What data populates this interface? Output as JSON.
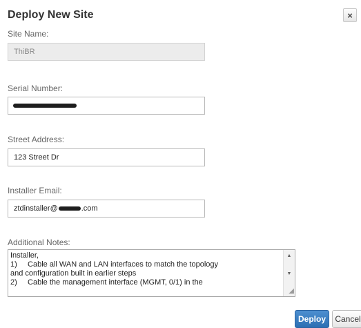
{
  "dialog": {
    "title": "Deploy New Site",
    "close_label": "×"
  },
  "fields": {
    "site_name": {
      "label": "Site Name:",
      "value": "ThiBR",
      "disabled": true
    },
    "serial_number": {
      "label": "Serial Number:",
      "value_redacted": true
    },
    "street_address": {
      "label": "Street Address:",
      "value": "123 Street Dr"
    },
    "installer_email": {
      "label": "Installer Email:",
      "value_prefix": "ztdinstaller@",
      "value_suffix": ".com",
      "domain_redacted": true
    },
    "additional_notes": {
      "label": "Additional Notes:",
      "value": "Installer,\n1)     Cable all WAN and LAN interfaces to match the topology\nand configuration built in earlier steps\n2)     Cable the management interface (MGMT, 0/1) in the"
    }
  },
  "buttons": {
    "deploy": "Deploy",
    "cancel": "Cancel"
  },
  "colors": {
    "primary_button": "#2c6fb3",
    "disabled_field": "#ececec",
    "redaction": "#1e1e1e"
  },
  "icons": {
    "close": "close-icon",
    "scroll_up": "scroll-up-arrow-icon",
    "scroll_down": "scroll-down-arrow-icon",
    "resize": "resize-grip-icon"
  }
}
